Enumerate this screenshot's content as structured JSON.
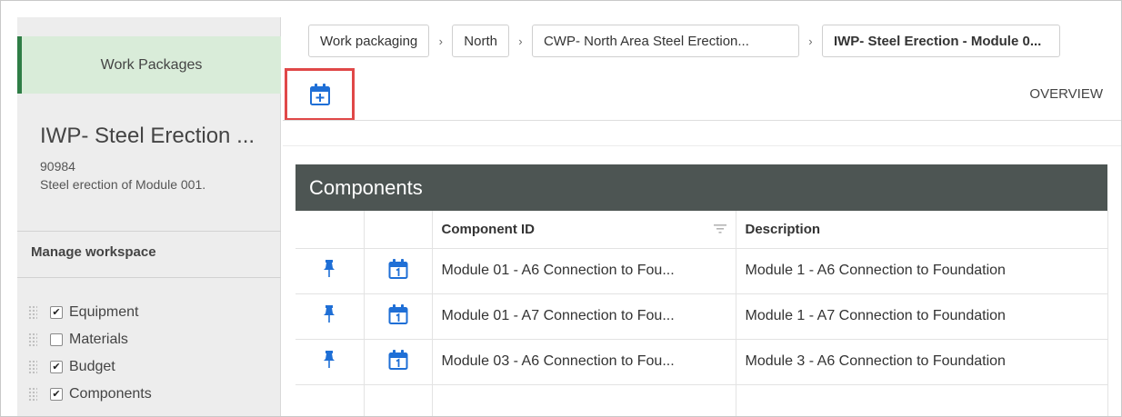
{
  "sidebar": {
    "header": "Work Packages",
    "title": "IWP- Steel Erection ...",
    "id": "90984",
    "description": "Steel erection of Module 001.",
    "manage_label": "Manage workspace",
    "items": [
      {
        "label": "Equipment",
        "checked": true
      },
      {
        "label": "Materials",
        "checked": false
      },
      {
        "label": "Budget",
        "checked": true
      },
      {
        "label": "Components",
        "checked": true
      }
    ]
  },
  "breadcrumbs": {
    "items": [
      "Work packaging",
      "North",
      "CWP- North Area Steel Erection...",
      "IWP- Steel Erection - Module 0..."
    ],
    "separator": "›"
  },
  "toolbar": {
    "add_icon": "calendar-plus-icon",
    "overview_label": "OVERVIEW"
  },
  "components": {
    "title": "Components",
    "columns": [
      "",
      "",
      "Component ID",
      "Description"
    ],
    "rows": [
      {
        "id": "Module 01 - A6 Connection to Fou...",
        "description": "Module 1 - A6 Connection to Foundation"
      },
      {
        "id": "Module 01 - A7 Connection to Fou...",
        "description": "Module 1 - A7 Connection to Foundation"
      },
      {
        "id": "Module 03 - A6 Connection to Fou...",
        "description": "Module 3 - A6 Connection to Foundation"
      }
    ]
  },
  "colors": {
    "accent_blue": "#1f6fd6",
    "highlight_red": "#e04848",
    "panel_header": "#4d5553",
    "sidebar_head_bg": "#d9ecd9",
    "sidebar_head_border": "#2f7d46"
  }
}
